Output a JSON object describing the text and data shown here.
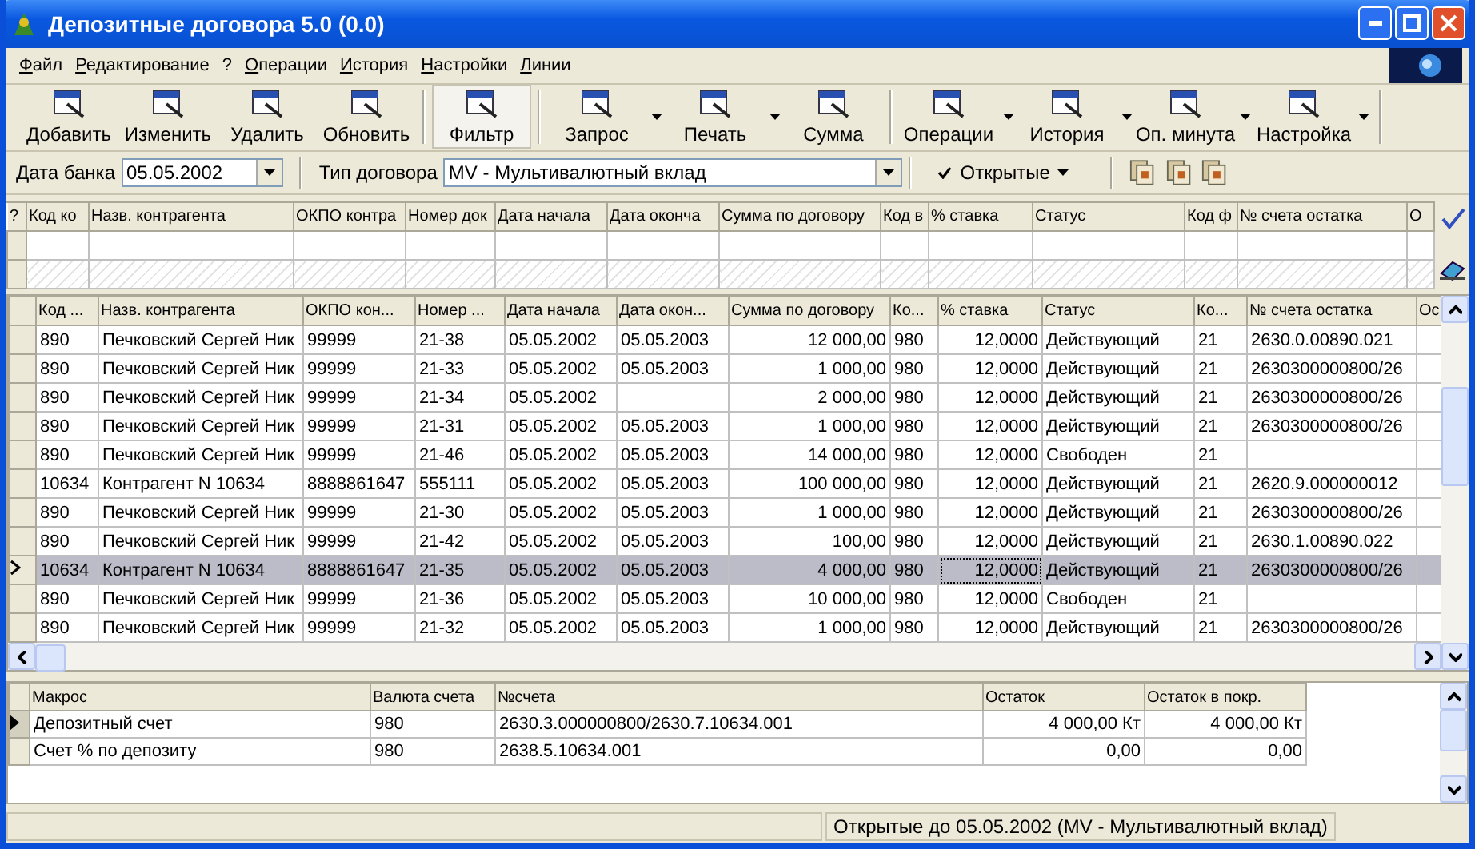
{
  "window": {
    "title": "Депозитные договора 5.0 (0.0)"
  },
  "menu": [
    "Файл",
    "Редактирование",
    "?",
    "Операции",
    "История",
    "Настройки",
    "Линии"
  ],
  "toolbar": [
    {
      "label": "Добавить",
      "pressed": false,
      "has_menu": false
    },
    {
      "label": "Изменить",
      "pressed": false,
      "has_menu": false
    },
    {
      "label": "Удалить",
      "pressed": false,
      "has_menu": false
    },
    {
      "label": "Обновить",
      "pressed": false,
      "has_menu": false
    },
    {
      "label": "Фильтр",
      "pressed": true,
      "has_menu": false
    },
    {
      "label": "Запрос",
      "pressed": false,
      "has_menu": true
    },
    {
      "label": "Печать",
      "pressed": false,
      "has_menu": true
    },
    {
      "label": "Сумма",
      "pressed": false,
      "has_menu": false
    },
    {
      "label": "Операции",
      "pressed": false,
      "has_menu": true
    },
    {
      "label": "История",
      "pressed": false,
      "has_menu": true
    },
    {
      "label": "Оп. минута",
      "pressed": false,
      "has_menu": true
    },
    {
      "label": "Настройка",
      "pressed": false,
      "has_menu": true
    }
  ],
  "filter_bar": {
    "bank_date_label": "Дата банка",
    "bank_date": "05.05.2002",
    "contract_type_label": "Тип договора",
    "contract_type": "MV - Мультивалютный вклад",
    "open_filter": {
      "label": "Открытые",
      "checked": true
    }
  },
  "filter_grid": {
    "columns": [
      "?",
      "Код ко",
      "Назв. контрагента",
      "ОКПО контра",
      "Номер док",
      "Дата начала",
      "Дата оконча",
      "Сумма по договору",
      "Код в",
      "% ставка",
      "Статус",
      "Код ф",
      "№ счета остатка",
      "О"
    ]
  },
  "table": {
    "columns": [
      "Код ...",
      "Назв. контрагента",
      "ОКПО кон...",
      "Номер ...",
      "Дата начала",
      "Дата окон...",
      "Сумма по договору",
      "Ко...",
      "% ставка",
      "Статус",
      "Ко...",
      "№ счета остатка",
      "Ос"
    ],
    "rows": [
      {
        "selected": false,
        "cells": [
          "890",
          "Печковский Сергей Ник",
          "99999",
          "21-38",
          "05.05.2002",
          "05.05.2003",
          "12 000,00",
          "980",
          "12,0000",
          "Действующий",
          "21",
          "2630.0.00890.021"
        ]
      },
      {
        "selected": false,
        "cells": [
          "890",
          "Печковский Сергей Ник",
          "99999",
          "21-33",
          "05.05.2002",
          "05.05.2003",
          "1 000,00",
          "980",
          "12,0000",
          "Действующий",
          "21",
          "2630300000800/26"
        ]
      },
      {
        "selected": false,
        "cells": [
          "890",
          "Печковский Сергей Ник",
          "99999",
          "21-34",
          "05.05.2002",
          null,
          "2 000,00",
          "980",
          "12,0000",
          "Действующий",
          "21",
          "2630300000800/26"
        ]
      },
      {
        "selected": false,
        "cells": [
          "890",
          "Печковский Сергей Ник",
          "99999",
          "21-31",
          "05.05.2002",
          "05.05.2003",
          "1 000,00",
          "980",
          "12,0000",
          "Действующий",
          "21",
          "2630300000800/26"
        ]
      },
      {
        "selected": false,
        "cells": [
          "890",
          "Печковский Сергей Ник",
          "99999",
          "21-46",
          "05.05.2002",
          "05.05.2003",
          "14 000,00",
          "980",
          "12,0000",
          "Свободен",
          "21",
          null
        ]
      },
      {
        "selected": false,
        "cells": [
          "10634",
          "Контрагент N 10634",
          "8888861647",
          "555111",
          "05.05.2002",
          "05.05.2003",
          "100 000,00",
          "980",
          "12,0000",
          "Действующий",
          "21",
          "2620.9.000000012"
        ]
      },
      {
        "selected": false,
        "cells": [
          "890",
          "Печковский Сергей Ник",
          "99999",
          "21-30",
          "05.05.2002",
          "05.05.2003",
          "1 000,00",
          "980",
          "12,0000",
          "Действующий",
          "21",
          "2630300000800/26"
        ]
      },
      {
        "selected": false,
        "cells": [
          "890",
          "Печковский Сергей Ник",
          "99999",
          "21-42",
          "05.05.2002",
          "05.05.2003",
          "100,00",
          "980",
          "12,0000",
          "Действующий",
          "21",
          "2630.1.00890.022"
        ]
      },
      {
        "selected": true,
        "cells": [
          "10634",
          "Контрагент N 10634",
          "8888861647",
          "21-35",
          "05.05.2002",
          "05.05.2003",
          "4 000,00",
          "980",
          "12,0000",
          "Действующий",
          "21",
          "2630300000800/26"
        ]
      },
      {
        "selected": false,
        "cells": [
          "890",
          "Печковский Сергей Ник",
          "99999",
          "21-36",
          "05.05.2002",
          "05.05.2003",
          "10 000,00",
          "980",
          "12,0000",
          "Свободен",
          "21",
          null
        ]
      },
      {
        "selected": false,
        "cells": [
          "890",
          "Печковский Сергей Ник",
          "99999",
          "21-32",
          "05.05.2002",
          "05.05.2003",
          "1 000,00",
          "980",
          "12,0000",
          "Действующий",
          "21",
          "2630300000800/26"
        ]
      }
    ]
  },
  "accounts": {
    "columns": [
      "Макрос",
      "Валюта счета",
      "№счета",
      "Остаток",
      "Остаток в покр."
    ],
    "rows": [
      {
        "selected": true,
        "cells": [
          "Депозитный счет",
          "980",
          "2630.3.000000800/2630.7.10634.001",
          "4 000,00 Кт",
          "4 000,00 Кт"
        ]
      },
      {
        "selected": false,
        "cells": [
          "Счет % по депозиту",
          "980",
          "2638.5.10634.001",
          "0,00",
          "0,00"
        ]
      }
    ]
  },
  "status_bar": {
    "text": "Открытые до 05.05.2002 (MV - Мультивалютный вклад)"
  }
}
